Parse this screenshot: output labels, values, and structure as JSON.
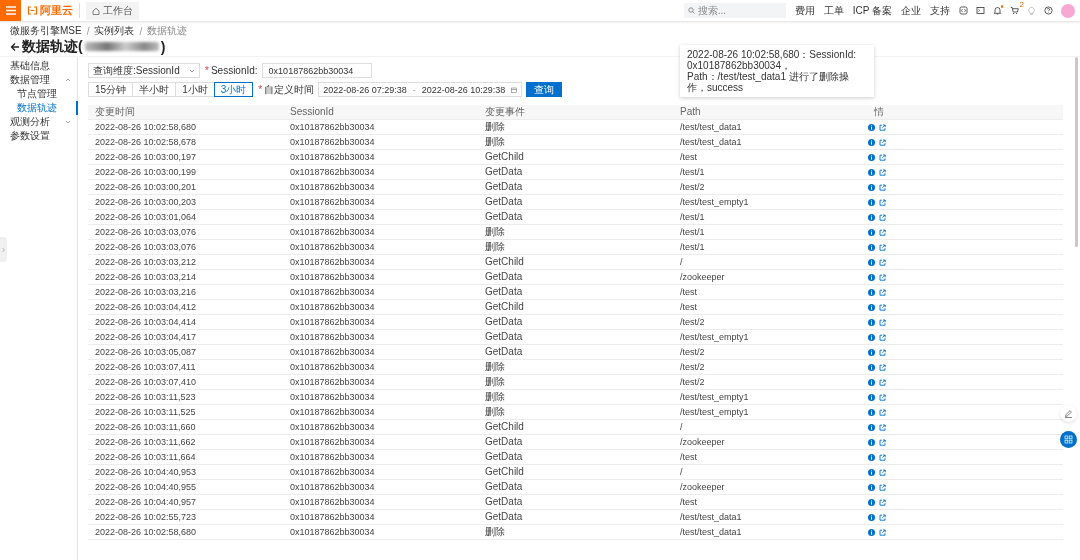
{
  "topbar": {
    "logo": "阿里云",
    "workbench": "工作台",
    "search": {
      "placeholder": "搜索..."
    },
    "links": [
      "费用",
      "工单",
      "ICP 备案",
      "企业",
      "支持"
    ],
    "has_unread": true,
    "cart_badge": "2"
  },
  "breadcrumb": {
    "separator": "/",
    "items": [
      {
        "label": "微服务引擎MSE",
        "current": false
      },
      {
        "label": "实例列表",
        "current": false
      },
      {
        "label": "数据轨迹",
        "current": true
      }
    ]
  },
  "page_title": {
    "text": "数据轨迹(",
    "close": ")"
  },
  "sidebar": {
    "items": [
      {
        "label": "基础信息",
        "selected": false
      },
      {
        "label": "数据管理",
        "selected": false,
        "expanded": true,
        "children": [
          {
            "label": "节点管理",
            "selected": false
          },
          {
            "label": "数据轨迹",
            "selected": true
          }
        ]
      },
      {
        "label": "观测分析",
        "selected": false,
        "expanded": false
      },
      {
        "label": "参数设置",
        "selected": false
      }
    ]
  },
  "filters": {
    "dimension_select": "查询维度:SessionId",
    "session_label": {
      "mark": "*",
      "text": "SessionId:"
    },
    "session_value": "0x10187862bb30034",
    "quick_ranges": [
      {
        "label": "15分钟",
        "selected": false
      },
      {
        "label": "半小时",
        "selected": false
      },
      {
        "label": "1小时",
        "selected": false
      },
      {
        "label": "3小时",
        "selected": true
      }
    ],
    "time_label": {
      "mark": "*",
      "text": "自定义时间"
    },
    "start": "2022-08-26 07:29:38",
    "separator": "-",
    "end": "2022-08-26 10:29:38",
    "query_button": "查询"
  },
  "table": {
    "columns": [
      "变更时间",
      "SessionId",
      "变更事件",
      "Path",
      "情"
    ],
    "rows": [
      {
        "time": "2022-08-26 10:02:58,680",
        "session": "0x10187862bb30034",
        "event": "删除",
        "path": "/test/test_data1"
      },
      {
        "time": "2022-08-26 10:02:58,678",
        "session": "0x10187862bb30034",
        "event": "删除",
        "path": "/test/test_data1"
      },
      {
        "time": "2022-08-26 10:03:00,197",
        "session": "0x10187862bb30034",
        "event": "GetChild",
        "path": "/test"
      },
      {
        "time": "2022-08-26 10:03:00,199",
        "session": "0x10187862bb30034",
        "event": "GetData",
        "path": "/test/1"
      },
      {
        "time": "2022-08-26 10:03:00,201",
        "session": "0x10187862bb30034",
        "event": "GetData",
        "path": "/test/2"
      },
      {
        "time": "2022-08-26 10:03:00,203",
        "session": "0x10187862bb30034",
        "event": "GetData",
        "path": "/test/test_empty1"
      },
      {
        "time": "2022-08-26 10:03:01,064",
        "session": "0x10187862bb30034",
        "event": "GetData",
        "path": "/test/1"
      },
      {
        "time": "2022-08-26 10:03:03,076",
        "session": "0x10187862bb30034",
        "event": "删除",
        "path": "/test/1"
      },
      {
        "time": "2022-08-26 10:03:03,076",
        "session": "0x10187862bb30034",
        "event": "删除",
        "path": "/test/1"
      },
      {
        "time": "2022-08-26 10:03:03,212",
        "session": "0x10187862bb30034",
        "event": "GetChild",
        "path": "/"
      },
      {
        "time": "2022-08-26 10:03:03,214",
        "session": "0x10187862bb30034",
        "event": "GetData",
        "path": "/zookeeper"
      },
      {
        "time": "2022-08-26 10:03:03,216",
        "session": "0x10187862bb30034",
        "event": "GetData",
        "path": "/test"
      },
      {
        "time": "2022-08-26 10:03:04,412",
        "session": "0x10187862bb30034",
        "event": "GetChild",
        "path": "/test"
      },
      {
        "time": "2022-08-26 10:03:04,414",
        "session": "0x10187862bb30034",
        "event": "GetData",
        "path": "/test/2"
      },
      {
        "time": "2022-08-26 10:03:04,417",
        "session": "0x10187862bb30034",
        "event": "GetData",
        "path": "/test/test_empty1"
      },
      {
        "time": "2022-08-26 10:03:05,087",
        "session": "0x10187862bb30034",
        "event": "GetData",
        "path": "/test/2"
      },
      {
        "time": "2022-08-26 10:03:07,411",
        "session": "0x10187862bb30034",
        "event": "删除",
        "path": "/test/2"
      },
      {
        "time": "2022-08-26 10:03:07,410",
        "session": "0x10187862bb30034",
        "event": "删除",
        "path": "/test/2"
      },
      {
        "time": "2022-08-26 10:03:11,523",
        "session": "0x10187862bb30034",
        "event": "删除",
        "path": "/test/test_empty1"
      },
      {
        "time": "2022-08-26 10:03:11,525",
        "session": "0x10187862bb30034",
        "event": "删除",
        "path": "/test/test_empty1"
      },
      {
        "time": "2022-08-26 10:03:11,660",
        "session": "0x10187862bb30034",
        "event": "GetChild",
        "path": "/"
      },
      {
        "time": "2022-08-26 10:03:11,662",
        "session": "0x10187862bb30034",
        "event": "GetData",
        "path": "/zookeeper"
      },
      {
        "time": "2022-08-26 10:03:11,664",
        "session": "0x10187862bb30034",
        "event": "GetData",
        "path": "/test"
      },
      {
        "time": "2022-08-26 10:04:40,953",
        "session": "0x10187862bb30034",
        "event": "GetChild",
        "path": "/"
      },
      {
        "time": "2022-08-26 10:04:40,955",
        "session": "0x10187862bb30034",
        "event": "GetData",
        "path": "/zookeeper"
      },
      {
        "time": "2022-08-26 10:04:40,957",
        "session": "0x10187862bb30034",
        "event": "GetData",
        "path": "/test"
      },
      {
        "time": "2022-08-26 10:02:55,723",
        "session": "0x10187862bb30034",
        "event": "GetData",
        "path": "/test/test_data1"
      },
      {
        "time": "2022-08-26 10:02:58,680",
        "session": "0x10187862bb30034",
        "event": "删除",
        "path": "/test/test_data1"
      }
    ]
  },
  "tooltip": {
    "text": "2022-08-26 10:02:58,680：SessionId: 0x10187862bb30034，Path：/test/test_data1 进行了删除操作，success"
  }
}
